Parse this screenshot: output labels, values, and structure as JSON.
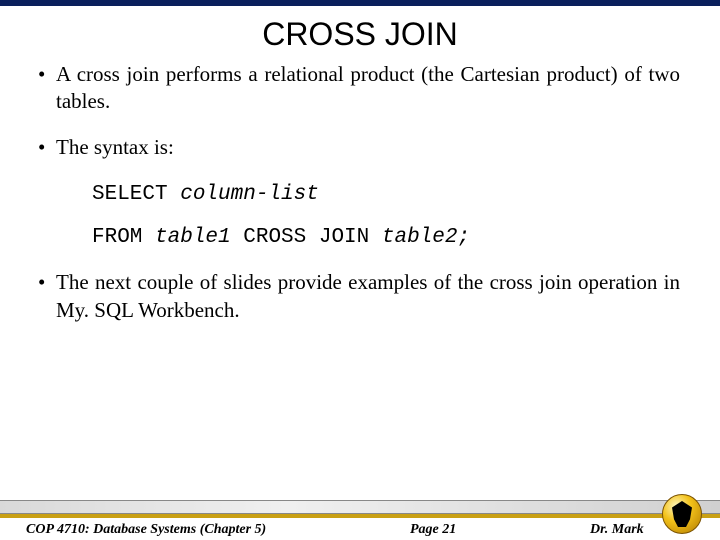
{
  "title": "CROSS JOIN",
  "bullets": {
    "b1": "A cross join performs a relational product (the Cartesian product) of two tables.",
    "b2": "The syntax is:",
    "b3": "The next couple of slides provide examples of the cross join operation in My. SQL Workbench."
  },
  "code": {
    "select": "SELECT ",
    "collist": "column-list",
    "from": "FROM ",
    "t1": "table1",
    "cross": " CROSS JOIN ",
    "t2": "table2;"
  },
  "footer": {
    "left": "COP 4710: Database Systems  (Chapter 5)",
    "mid": "Page 21",
    "right": "Dr. Mark"
  }
}
